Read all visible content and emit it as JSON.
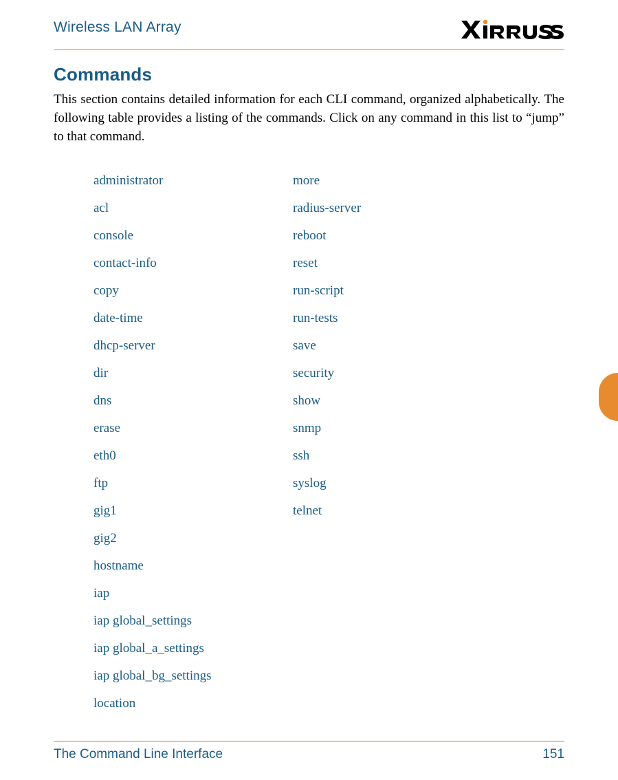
{
  "header": {
    "doc_title": "Wireless LAN Array",
    "brand": "XIRRUS"
  },
  "section": {
    "title": "Commands",
    "intro": "This section contains detailed information for each CLI command, organized alphabetically. The following table provides a listing of the commands. Click on any command in this list to “jump” to that command."
  },
  "commands": {
    "rows": [
      {
        "left": "administrator",
        "right": "more"
      },
      {
        "left": "acl",
        "right": "radius-server"
      },
      {
        "left": "console",
        "right": "reboot"
      },
      {
        "left": "contact-info",
        "right": "reset"
      },
      {
        "left": "copy",
        "right": "run-script"
      },
      {
        "left": "date-time",
        "right": "run-tests"
      },
      {
        "left": "dhcp-server",
        "right": "save"
      },
      {
        "left": "dir",
        "right": "security"
      },
      {
        "left": "dns",
        "right": "show"
      },
      {
        "left": "erase",
        "right": "snmp"
      },
      {
        "left": "eth0",
        "right": "ssh"
      },
      {
        "left": "ftp",
        "right": "syslog"
      },
      {
        "left": "gig1",
        "right": "telnet"
      },
      {
        "left": "gig2",
        "right": ""
      },
      {
        "left": "hostname",
        "right": ""
      },
      {
        "left": "iap",
        "right": ""
      },
      {
        "left": "iap global_settings",
        "right": ""
      },
      {
        "left": "iap global_a_settings",
        "right": ""
      },
      {
        "left": "iap global_bg_settings",
        "right": ""
      },
      {
        "left": "location",
        "right": ""
      }
    ]
  },
  "footer": {
    "section_name": "The Command Line Interface",
    "page_number": "151"
  }
}
